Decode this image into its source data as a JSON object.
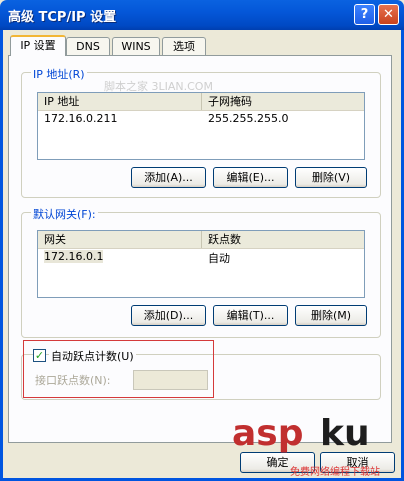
{
  "window": {
    "title": "高级 TCP/IP 设置",
    "help_glyph": "?",
    "close_glyph": "✕"
  },
  "tabs": [
    {
      "label": "IP 设置",
      "active": true
    },
    {
      "label": "DNS",
      "active": false
    },
    {
      "label": "WINS",
      "active": false
    },
    {
      "label": "选项",
      "active": false
    }
  ],
  "ip_group": {
    "label": "IP 地址(R)",
    "columns": [
      "IP 地址",
      "子网掩码"
    ],
    "rows": [
      {
        "ip": "172.16.0.211",
        "mask": "255.255.255.0"
      }
    ],
    "buttons": {
      "add": "添加(A)...",
      "edit": "编辑(E)...",
      "delete": "删除(V)"
    }
  },
  "gateway_group": {
    "label": "默认网关(F):",
    "columns": [
      "网关",
      "跃点数"
    ],
    "rows": [
      {
        "gateway": "172.16.0.1",
        "metric": "自动"
      }
    ],
    "buttons": {
      "add": "添加(D)...",
      "edit": "编辑(T)...",
      "delete": "删除(M)"
    }
  },
  "metric": {
    "auto_label": "自动跃点计数(U)",
    "auto_checked": true,
    "interface_label": "接口跃点数(N):",
    "interface_value": ""
  },
  "footer": {
    "ok_label": "确定",
    "cancel_label": "取消"
  },
  "watermarks": {
    "center": "脚本之家 3LIAN.COM",
    "logo_asp": "asp",
    "logo_ku": "ku",
    "logo_sub": "免费网络编程下载站"
  },
  "colors": {
    "title_bar": "#0054e3",
    "tab_highlight": "#f2b636",
    "highlight_box": "#d43a3a",
    "group_label": "#0046d5"
  }
}
